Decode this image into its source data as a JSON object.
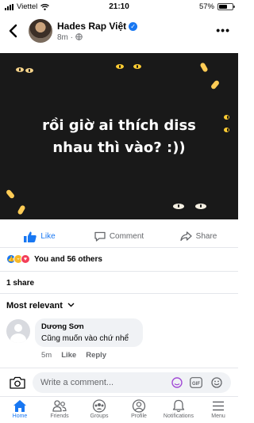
{
  "status_bar": {
    "carrier": "Viettel",
    "time": "21:10",
    "battery": "57%"
  },
  "header": {
    "page_name": "Hades Rap Việt",
    "post_time": "8m ·"
  },
  "post": {
    "image_text_line1": "rồi giờ ai thích diss",
    "image_text_line2": "nhau thì vào? :))"
  },
  "actions": {
    "like": "Like",
    "comment": "Comment",
    "share": "Share"
  },
  "reactions": {
    "summary": "You and 56 others"
  },
  "shares": "1 share",
  "comments_filter": "Most relevant",
  "comment": {
    "author": "Dương Sơn",
    "text": "Cũng muốn vào chứ nhể",
    "time": "5m",
    "like": "Like",
    "reply": "Reply"
  },
  "composer": {
    "placeholder": "Write a comment..."
  },
  "bottom_nav": {
    "home": "Home",
    "friends": "Friends",
    "groups": "Groups",
    "profile": "Profile",
    "notifications": "Notifications",
    "menu": "Menu"
  },
  "colors": {
    "accent": "#1877f2",
    "muted": "#65676b",
    "image_bg": "#191919"
  }
}
